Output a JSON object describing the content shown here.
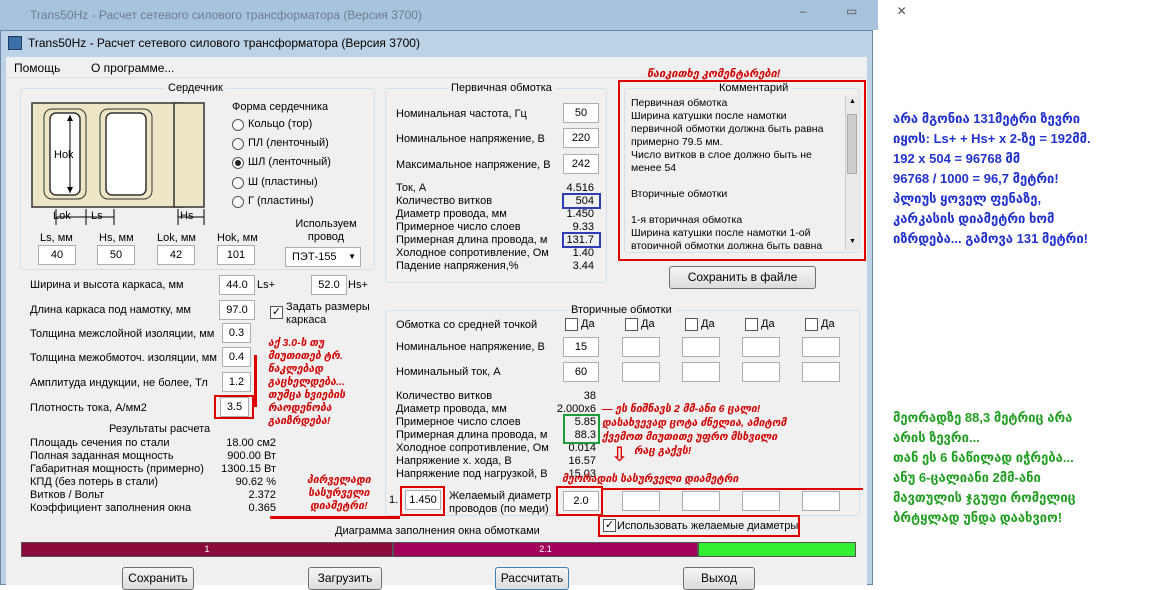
{
  "background_window": {
    "title": "Trans50Hz - Расчет сетевого силового трансформатора (Версия 3700)"
  },
  "window": {
    "title": "Trans50Hz - Расчет сетевого силового трансформатора (Версия 3700)"
  },
  "menu": {
    "help": "Помощь",
    "about": "О программе..."
  },
  "core": {
    "group_title": "Сердечник",
    "diagram_labels": {
      "hok": "Hok",
      "lok": "Lok",
      "ls": "Ls",
      "hs": "Hs"
    },
    "shape_title": "Форма сердечника",
    "shapes": [
      {
        "label": "Кольцо  (тор)",
        "selected": false
      },
      {
        "label": "ПЛ  (ленточный)",
        "selected": false
      },
      {
        "label": "ШЛ  (ленточный)",
        "selected": true
      },
      {
        "label": "Ш  (пластины)",
        "selected": false
      },
      {
        "label": "Г  (пластины)",
        "selected": false
      }
    ],
    "dims": [
      {
        "label": "Ls, мм",
        "value": "40"
      },
      {
        "label": "Hs, мм",
        "value": "50"
      },
      {
        "label": "Lok, мм",
        "value": "42"
      },
      {
        "label": "Hok, мм",
        "value": "101"
      }
    ],
    "wire_title": "Используем провод",
    "wire_value": "ПЭТ-155"
  },
  "params": {
    "frame_label": "Ширина и высота каркаса, мм",
    "frame_w": "44.0",
    "frame_w_suffix": "Ls+",
    "frame_h": "52.0",
    "frame_h_suffix": "Hs+",
    "winding_len_label": "Длина каркаса под намотку, мм",
    "winding_len": "97.0",
    "set_frame_label": "Задать размеры каркаса",
    "set_frame_checked": true,
    "interlayer_label": "Толщина межслойной изоляции, мм",
    "interlayer": "0.3",
    "interwinding_label": "Толщина межобмоточ. изоляции, мм",
    "interwinding": "0.4",
    "induction_label": "Амплитуда индукции, не более, Тл",
    "induction": "1.2",
    "current_density_label": "Плотность тока, А/мм2",
    "current_density": "3.5"
  },
  "results": {
    "title": "Результаты расчета",
    "rows": [
      {
        "label": "Площадь сечения по стали",
        "value": "18.00 см2"
      },
      {
        "label": "Полная заданная мощность",
        "value": "900.00 Вт"
      },
      {
        "label": "Габаритная мощность (примерно)",
        "value": "1300.15 Вт"
      },
      {
        "label": "КПД (без потерь в стали)",
        "value": "90.62 %"
      },
      {
        "label": "Витков / Вольт",
        "value": "2.372"
      },
      {
        "label": "Коэффициент заполнения окна",
        "value": "0.365"
      }
    ]
  },
  "primary": {
    "title": "Первичная обмотка",
    "freq_label": "Номинальная частота, Гц",
    "freq": "50",
    "voltage_label": "Номинальное напряжение, В",
    "voltage": "220",
    "max_voltage_label": "Максимальное напряжение, В",
    "max_voltage": "242",
    "rows": [
      {
        "label": "Ток, А",
        "value": "4.516"
      },
      {
        "label": "Количество витков",
        "value": "504"
      },
      {
        "label": "Диаметр провода, мм",
        "value": "1.450"
      },
      {
        "label": "Примерное число слоев",
        "value": "9.33"
      },
      {
        "label": "Примерная длина провода, м",
        "value": "131.7"
      },
      {
        "label": "Холодное сопротивление, Ом",
        "value": "1.40"
      },
      {
        "label": "Падение напряжения,%",
        "value": "3.44"
      }
    ]
  },
  "comments": {
    "title": "Комментарий",
    "text": "          Первичная обмотка\nШирина катушки после намотки\nпервичной обмотки должна быть равна\nпримерно 79.5 мм.\nЧисло витков в слое должно быть не\nменее 54\n\n          Вторичные обмотки\n\n     1-я вторичная обмотка\nШирина катушки после намотки 1-ой\nвторичной обмотки должна быть равна",
    "save_button": "Сохранить в файле"
  },
  "secondary": {
    "title": "Вторичные обмотки",
    "center_tap_label": "Обмотка со средней точкой",
    "checkbox_label": "Да",
    "voltage_label": "Номинальное напряжение, В",
    "voltage": "15",
    "current_label": "Номинальный ток, А",
    "current": "60",
    "rows": [
      {
        "label": "Количество витков",
        "value": "38"
      },
      {
        "label": "Диаметр провода, мм",
        "value": "2.000x6"
      },
      {
        "label": "Примерное число слоев",
        "value": "5.85"
      },
      {
        "label": "Примерная длина провода, м",
        "value": "88.3"
      },
      {
        "label": "Холодное сопротивление, Ом",
        "value": "0.014"
      },
      {
        "label": "Напряжение х. хода, В",
        "value": "16.57"
      },
      {
        "label": "Напряжение под нагрузкой, В",
        "value": "15.03"
      }
    ],
    "desired_diam_label_1": "Желаемый диаметр",
    "desired_diam_label_2": "проводов  (по меди)",
    "desired_primary_prefix": "1.",
    "desired_primary": "1.450",
    "desired_secondary": "2.0",
    "use_desired_label": "Использовать желаемые диаметры",
    "use_desired_checked": true
  },
  "fill_chart": {
    "title": "Диаграмма заполнения окна обмотками",
    "segments": [
      {
        "label": "1",
        "fraction": 0.446,
        "color": "#8b0a3c"
      },
      {
        "label": "2.1",
        "fraction": 0.365,
        "color": "#a3005a"
      },
      {
        "label": "",
        "fraction": 0.189,
        "color": "#33ee33"
      }
    ]
  },
  "buttons": {
    "save": "Сохранить",
    "load": "Загрузить",
    "calculate": "Рассчитать",
    "exit": "Выход"
  },
  "annotations": {
    "red_top": "წაიკითხე კომენტარები!",
    "red_left": [
      "აქ 3.0-ს თუ",
      "მიუთითებ ტრ.",
      "ნაკლებად",
      "გაცხელდება...",
      "თუმცა ხვიების",
      "რაოდენობა",
      "გაიზრდება!"
    ],
    "red_center": [
      "— ეს ნიშნავს 2 მმ-ანი 6 ცალი!",
      "დასახვევად ცოტა ძნელია, ამიტომ",
      "ქვემოთ მიუთითე უფრო მსხვილი",
      "რაც გაქვს!"
    ],
    "red_bottom_left": [
      "პირველადი",
      "სასურველი",
      "დიამეტრი!"
    ],
    "red_bottom_center": "მეორადის სასურველი დიამეტრი",
    "blue_note": [
      "არა მგონია 131მეტრი ზევრი",
      "იყოს: Ls+ + Hs+ x 2-ზე = 192მმ.",
      "192 x 504 = 96768 მმ",
      "96768 / 1000 = 96,7 მეტრი!",
      "პლიუს ყოველ ფენაზე,",
      "კარკასის დიამეტრი ხომ",
      "იზრდება... გამოვა 131 მეტრი!"
    ],
    "green_note": [
      "მეორადზე 88,3 მეტრიც არა",
      "არის ზევრი...",
      "თან ეს 6 ნაწილად იჭრება...",
      "ანუ 6-ცალიანი 2მმ-ანი",
      "მავთულის ჯგუფი რომელიც",
      "ბრტყლად უნდა დაახვიო!"
    ]
  }
}
